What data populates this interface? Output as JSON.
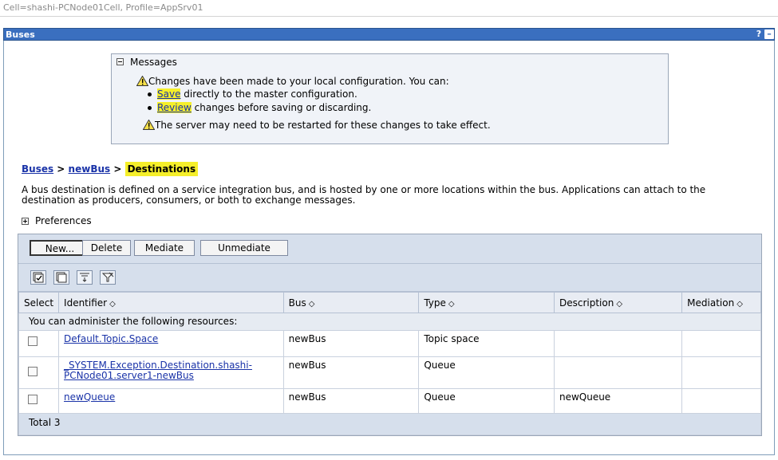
{
  "scope": "Cell=shashi-PCNode01Cell, Profile=AppSrv01",
  "window": {
    "title": "Buses",
    "help_label": "?",
    "minimize_label": "–"
  },
  "messages": {
    "title": "Messages",
    "line1": "Changes have been made to your local configuration. You can:",
    "save_link": "Save",
    "save_rest": " directly to the master configuration.",
    "review_link": "Review",
    "review_rest": " changes before saving or discarding.",
    "restart": "The server may need to be restarted for these changes to take effect."
  },
  "breadcrumb": {
    "item1": "Buses",
    "sep": " > ",
    "item2": "newBus",
    "current": "Destinations"
  },
  "description": "A bus destination is defined on a service integration bus, and is hosted by one or more locations within the bus. Applications can attach to the destination as producers, consumers, or both to exchange messages.",
  "preferences_label": "Preferences",
  "toolbar": {
    "new_label": "New...",
    "delete_label": "Delete",
    "mediate_label": "Mediate",
    "unmediate_label": "Unmediate"
  },
  "icons": [
    "select-all-icon",
    "deselect-all-icon",
    "show-filter-icon",
    "clear-filter-icon"
  ],
  "table": {
    "headers": {
      "select": "Select",
      "identifier": "Identifier",
      "bus": "Bus",
      "type": "Type",
      "description": "Description",
      "mediation": "Mediation"
    },
    "info": "You can administer the following resources:",
    "rows": [
      {
        "identifier": "Default.Topic.Space",
        "bus": "newBus",
        "type": "Topic space",
        "description": "",
        "mediation": ""
      },
      {
        "identifier": "_SYSTEM.Exception.Destination.shashi-PCNode01.server1-newBus",
        "bus": "newBus",
        "type": "Queue",
        "description": "",
        "mediation": ""
      },
      {
        "identifier": "newQueue",
        "bus": "newBus",
        "type": "Queue",
        "description": "newQueue",
        "mediation": ""
      }
    ],
    "total": "Total 3"
  },
  "colors": {
    "titlebar": "#3a6fbf",
    "highlight": "#f5ef2a",
    "link": "#1a33a8",
    "toolbar_bg": "#d6dfec"
  }
}
